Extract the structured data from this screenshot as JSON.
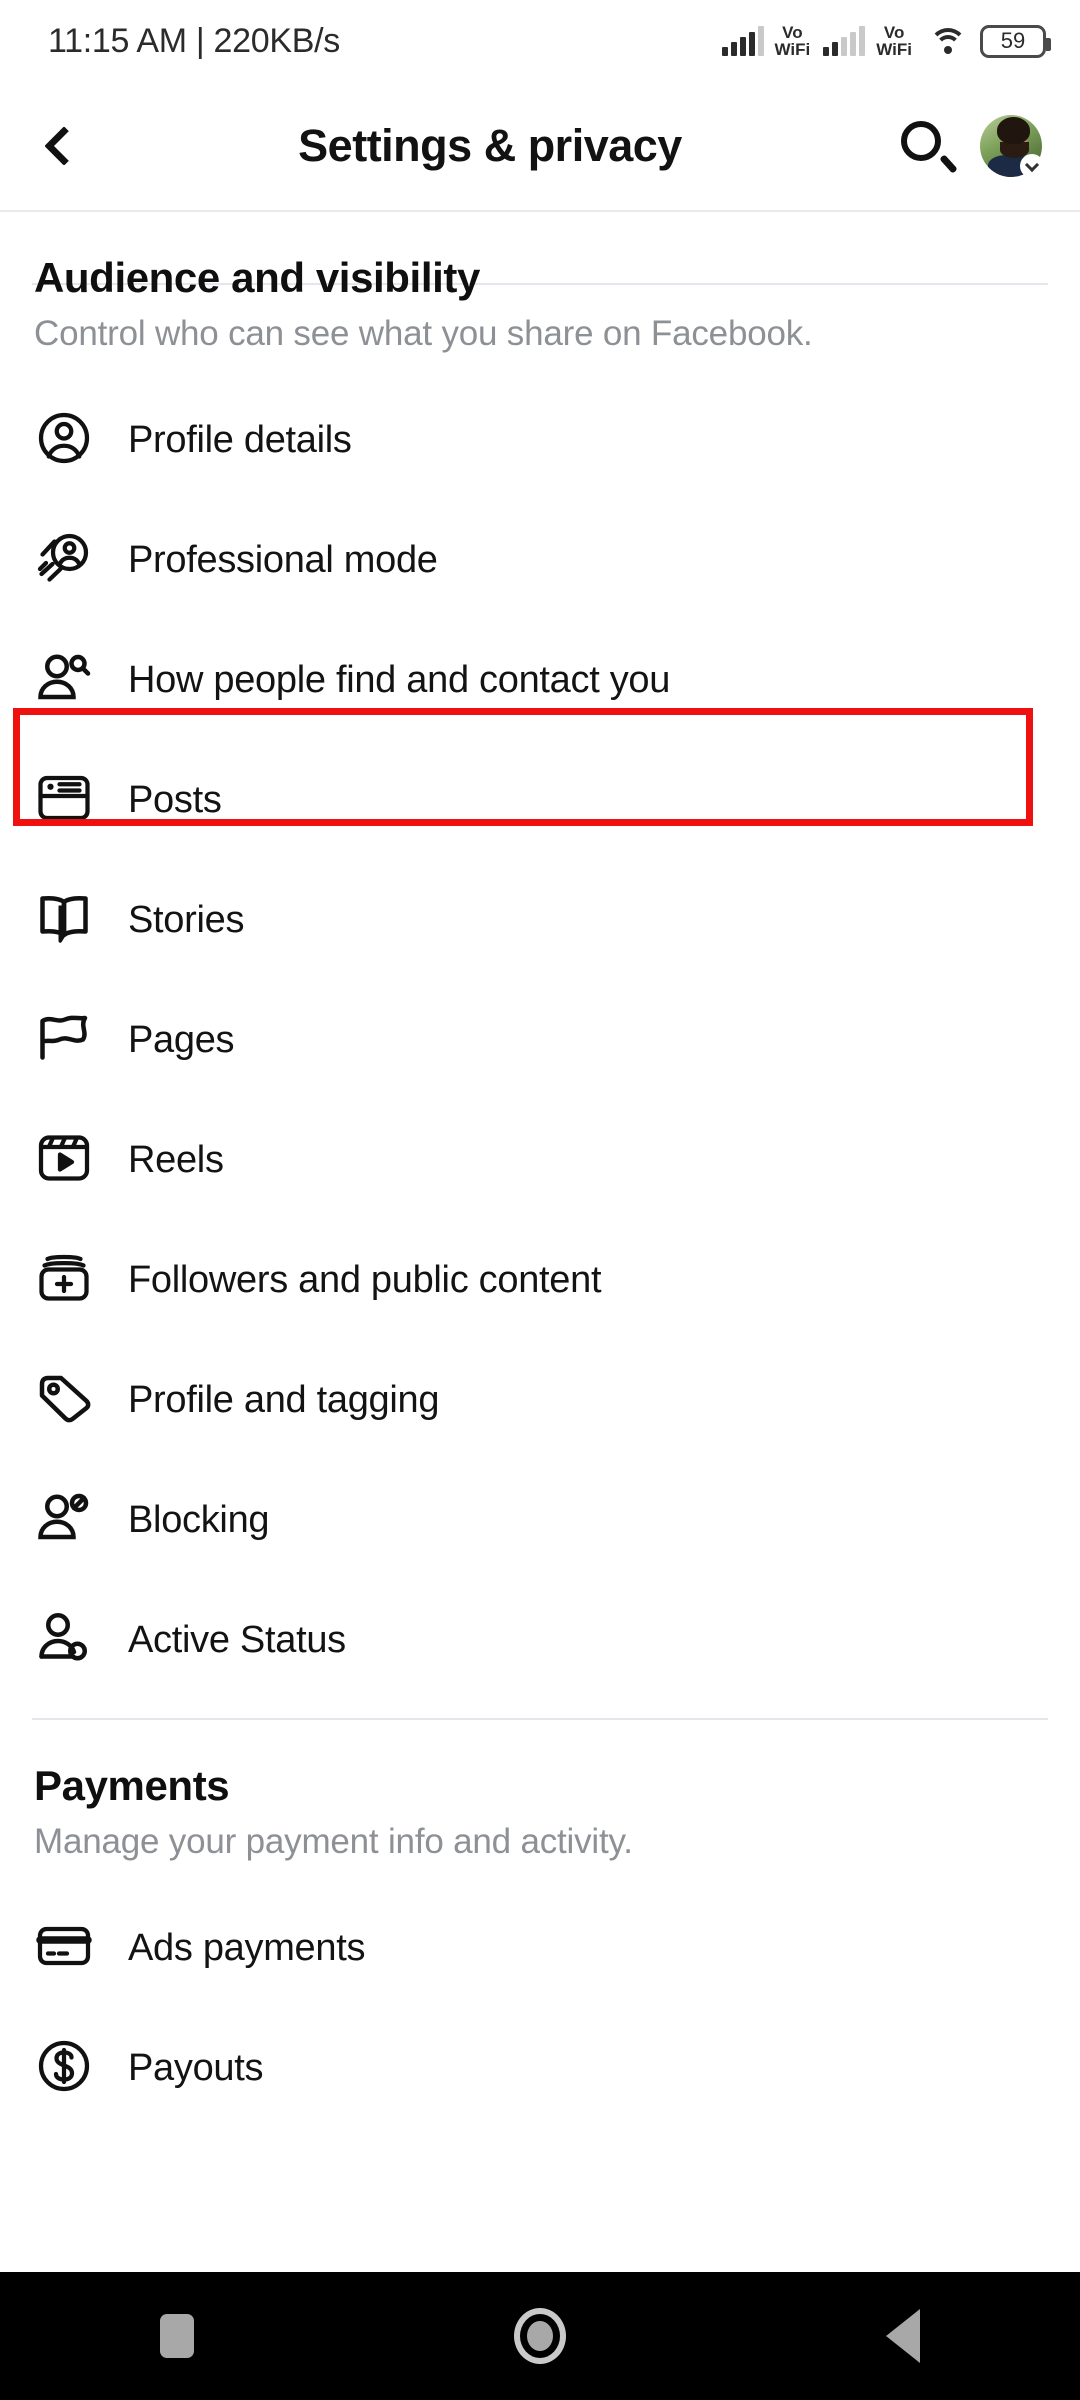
{
  "status_bar": {
    "time_and_speed": "11:15 AM | 220KB/s",
    "sim1_label": "Vo\nWiFi",
    "sim1_line1": "Vo",
    "sim1_line2": "WiFi",
    "sim2_line1": "Vo",
    "sim2_line2": "WiFi",
    "battery_level": "59",
    "icons": [
      "signal-bars-icon",
      "vowifi-icon",
      "signal-bars-icon",
      "vowifi-icon",
      "wifi-icon",
      "battery-icon"
    ]
  },
  "header": {
    "back_icon": "chevron-left-icon",
    "title": "Settings & privacy",
    "search_icon": "search-icon",
    "avatar_icon": "avatar",
    "avatar_chevron_icon": "chevron-down-icon"
  },
  "sections": [
    {
      "title": "Audience and visibility",
      "subtitle": "Control who can see what you share on Facebook.",
      "items": [
        {
          "label": "Profile details",
          "icon": "person-circle-icon",
          "highlighted": false
        },
        {
          "label": "Professional mode",
          "icon": "person-rocket-icon",
          "highlighted": false
        },
        {
          "label": "How people find and contact you",
          "icon": "person-search-icon",
          "highlighted": true
        },
        {
          "label": "Posts",
          "icon": "post-card-icon",
          "highlighted": false
        },
        {
          "label": "Stories",
          "icon": "open-book-icon",
          "highlighted": false
        },
        {
          "label": "Pages",
          "icon": "flag-icon",
          "highlighted": false
        },
        {
          "label": "Reels",
          "icon": "reels-play-icon",
          "highlighted": false
        },
        {
          "label": "Followers and public content",
          "icon": "stack-plus-icon",
          "highlighted": false
        },
        {
          "label": "Profile and tagging",
          "icon": "tag-icon",
          "highlighted": false
        },
        {
          "label": "Blocking",
          "icon": "person-block-icon",
          "highlighted": false
        },
        {
          "label": "Active Status",
          "icon": "person-status-icon",
          "highlighted": false
        }
      ]
    },
    {
      "title": "Payments",
      "subtitle": "Manage your payment info and activity.",
      "items": [
        {
          "label": "Ads payments",
          "icon": "credit-card-icon",
          "highlighted": false
        },
        {
          "label": "Payouts",
          "icon": "dollar-circle-icon",
          "highlighted": false
        }
      ]
    }
  ],
  "nav_bar": {
    "recents_icon": "square-icon",
    "home_icon": "circle-icon",
    "back_icon": "triangle-back-icon"
  },
  "colors": {
    "highlight_border": "#ef1010",
    "background": "#ffffff",
    "text_primary": "#131313",
    "text_secondary": "#8d9095",
    "divider": "#e4e6eb",
    "nav_bar_bg": "#000000"
  }
}
